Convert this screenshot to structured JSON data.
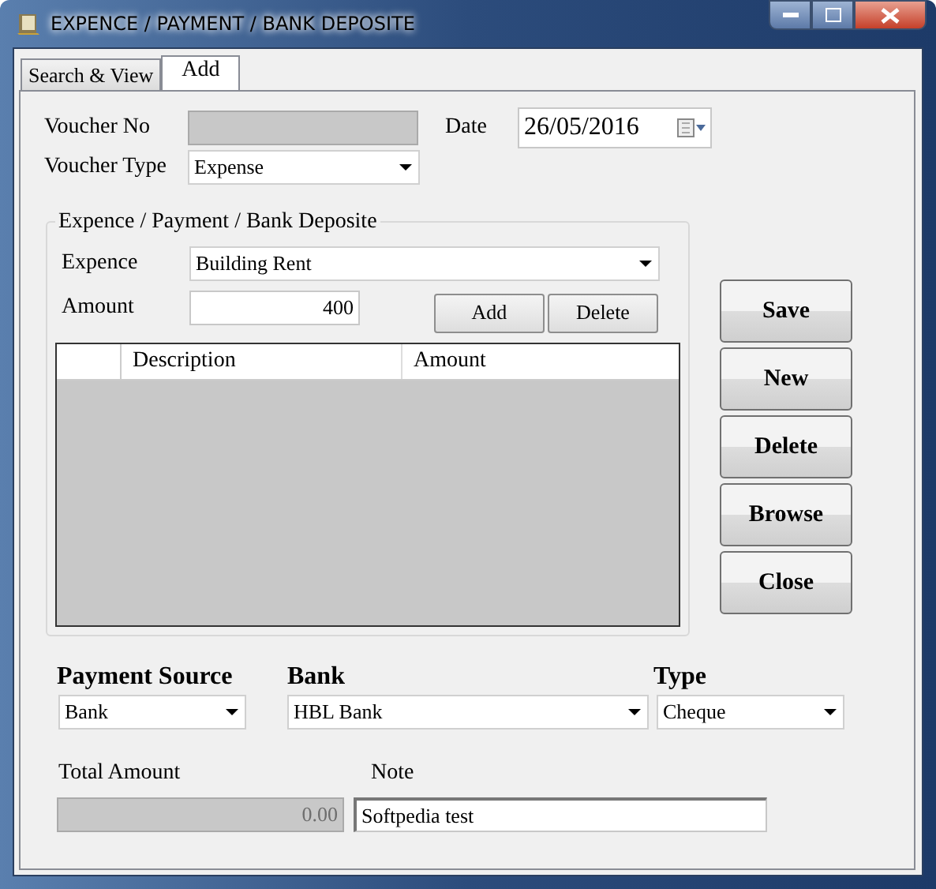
{
  "window": {
    "title": "EXPENCE / PAYMENT / BANK DEPOSITE"
  },
  "tabs": [
    {
      "label": "Search & View",
      "selected": false
    },
    {
      "label": "Add",
      "selected": true
    }
  ],
  "voucher_no": {
    "label": "Voucher No",
    "disabled": true
  },
  "date": {
    "label": "Date",
    "value": "26/05/2016"
  },
  "voucher_type": {
    "label": "Voucher Type",
    "value": "Expense"
  },
  "group": {
    "title": "Expence / Payment / Bank Deposite",
    "expence": {
      "label": "Expence",
      "value": "Building Rent"
    },
    "amount": {
      "label": "Amount",
      "value": "400"
    },
    "buttons": [
      "Add",
      "Delete"
    ],
    "table": {
      "columns": [
        "Description",
        "Amount"
      ]
    }
  },
  "actions": [
    "Save",
    "New",
    "Delete",
    "Browse",
    "Close"
  ],
  "payment_source": {
    "label": "Payment Source",
    "value": "Bank"
  },
  "bank": {
    "label": "Bank",
    "value": "HBL Bank"
  },
  "type": {
    "label": "Type",
    "value": "Cheque"
  },
  "total_amount": {
    "label": "Total Amount",
    "value": "0.00",
    "disabled": true
  },
  "note": {
    "label": "Note",
    "value": "Softpedia test"
  }
}
